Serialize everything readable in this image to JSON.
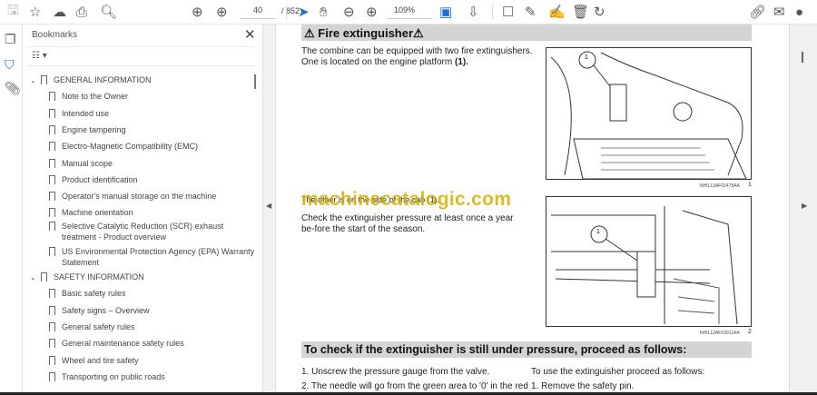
{
  "toolbar": {
    "page_current": "40",
    "page_total": "/ 852",
    "zoom": "109%"
  },
  "bookmarks": {
    "title": "Bookmarks",
    "items": [
      {
        "label": "GENERAL INFORMATION",
        "level": 0
      },
      {
        "label": "Note to the Owner",
        "level": 1
      },
      {
        "label": "Intended use",
        "level": 1
      },
      {
        "label": "Engine tampering",
        "level": 1
      },
      {
        "label": "Electro-Magnetic Compatibility (EMC)",
        "level": 1
      },
      {
        "label": "Manual scope",
        "level": 1
      },
      {
        "label": "Product identification",
        "level": 1
      },
      {
        "label": "Operator's manual storage on the machine",
        "level": 1
      },
      {
        "label": "Machine orientation",
        "level": 1
      },
      {
        "label": "Selective Catalytic Reduction (SCR) exhaust treatment - Product overview",
        "level": 1
      },
      {
        "label": "US Environmental Protection Agency (EPA) Warranty Statement",
        "level": 1
      },
      {
        "label": "SAFETY INFORMATION",
        "level": 0
      },
      {
        "label": "Basic safety rules",
        "level": 1
      },
      {
        "label": "Safety signs  – Overview",
        "level": 1
      },
      {
        "label": "General safety rules",
        "level": 1
      },
      {
        "label": "General maintenance safety rules",
        "level": 1
      },
      {
        "label": "Wheel and tire safety",
        "level": 1
      },
      {
        "label": "Transporting on public roads",
        "level": 1
      }
    ]
  },
  "doc": {
    "heading1": "Fire extinguisher",
    "para1a": "The combine can be equipped with two fire extinguishers.",
    "para1b": "One is located on the engine platform ",
    "para1c": "(1).",
    "para2": "The other is on the side of the cab (1).",
    "para3": "Check the extinguisher pressure at least once a year be-fore the start of the season.",
    "fig1_code": "NHIL13AF01478AA",
    "fig1_num": "1",
    "fig1_callout": "1",
    "fig2_code": "NHIL12AF03011AA",
    "fig2_num": "2",
    "fig2_callout": "1",
    "heading2": "To check if the extinguisher is still under pressure, proceed as follows:",
    "step1": "1.  Unscrew the pressure gauge from the valve.",
    "step2": "2.  The needle will go from the green area to '0' in the red",
    "use_title": "To use the extinguisher proceed as follows:",
    "use1": "1.  Remove the safety pin."
  },
  "watermark": "machinecatalogic.com"
}
